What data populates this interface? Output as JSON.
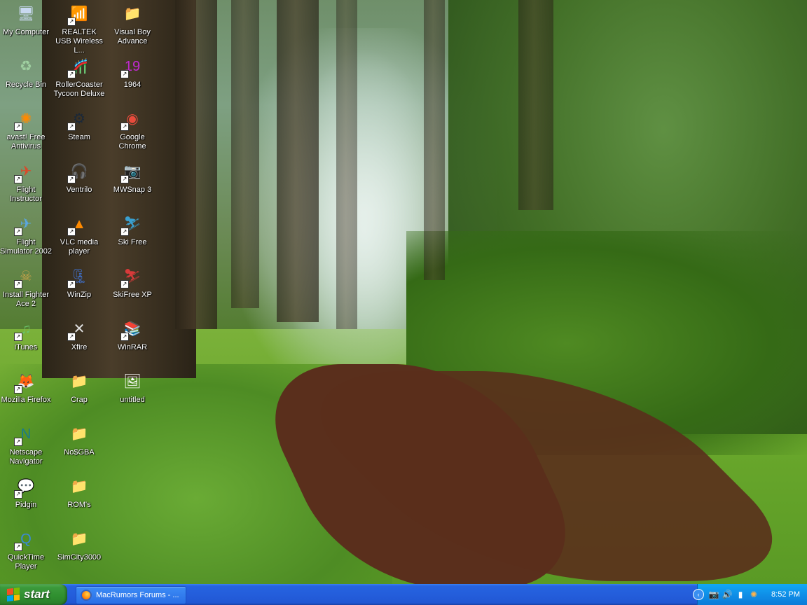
{
  "desktop": {
    "icons": [
      {
        "label": "My Computer",
        "glyph": "🖥",
        "color": "#c8d8f0",
        "shortcut": false,
        "col": 0,
        "row": 0
      },
      {
        "label": "REALTEK USB Wireless L...",
        "glyph": "📶",
        "color": "#1a3fbf",
        "shortcut": true,
        "col": 1,
        "row": 0
      },
      {
        "label": "Visual Boy Advance",
        "glyph": "📁",
        "color": "#f3d26b",
        "shortcut": false,
        "col": 2,
        "row": 0
      },
      {
        "label": "Recycle Bin",
        "glyph": "♻",
        "color": "#9fd0a0",
        "shortcut": false,
        "col": 0,
        "row": 1
      },
      {
        "label": "RollerCoaster Tycoon Deluxe",
        "glyph": "🎢",
        "color": "#c0282e",
        "shortcut": true,
        "col": 1,
        "row": 1
      },
      {
        "label": "1964",
        "glyph": "19",
        "color": "#c02ad0",
        "shortcut": true,
        "col": 2,
        "row": 1
      },
      {
        "label": "avast! Free Antivirus",
        "glyph": "✺",
        "color": "#ff8a00",
        "shortcut": true,
        "col": 0,
        "row": 2
      },
      {
        "label": "Steam",
        "glyph": "⚙",
        "color": "#1b2838",
        "shortcut": true,
        "col": 1,
        "row": 2
      },
      {
        "label": "Google Chrome",
        "glyph": "◉",
        "color": "#e84b3c",
        "shortcut": true,
        "col": 2,
        "row": 2
      },
      {
        "label": "Flight Instructor",
        "glyph": "✈",
        "color": "#d84a2a",
        "shortcut": true,
        "col": 0,
        "row": 3
      },
      {
        "label": "Ventrilo",
        "glyph": "🎧",
        "color": "#d8d8d8",
        "shortcut": true,
        "col": 1,
        "row": 3
      },
      {
        "label": "MWSnap 3",
        "glyph": "📷",
        "color": "#555555",
        "shortcut": true,
        "col": 2,
        "row": 3
      },
      {
        "label": "Flight Simulator 2002",
        "glyph": "✈",
        "color": "#5aa7e0",
        "shortcut": true,
        "col": 0,
        "row": 4
      },
      {
        "label": "VLC media player",
        "glyph": "▲",
        "color": "#ff8a00",
        "shortcut": true,
        "col": 1,
        "row": 4
      },
      {
        "label": "Ski Free",
        "glyph": "⛷",
        "color": "#3aa0d0",
        "shortcut": true,
        "col": 2,
        "row": 4
      },
      {
        "label": "Install Fighter Ace 2",
        "glyph": "☠",
        "color": "#c9a24a",
        "shortcut": true,
        "col": 0,
        "row": 5
      },
      {
        "label": "WinZip",
        "glyph": "🗜",
        "color": "#3f6fc8",
        "shortcut": true,
        "col": 1,
        "row": 5
      },
      {
        "label": "SkiFree XP",
        "glyph": "⛷",
        "color": "#d83a3a",
        "shortcut": true,
        "col": 2,
        "row": 5
      },
      {
        "label": "iTunes",
        "glyph": "♫",
        "color": "#6ac26a",
        "shortcut": true,
        "col": 0,
        "row": 6
      },
      {
        "label": "Xfire",
        "glyph": "✕",
        "color": "#e0e0e0",
        "shortcut": true,
        "col": 1,
        "row": 6
      },
      {
        "label": "WinRAR",
        "glyph": "📚",
        "color": "#9a2a7a",
        "shortcut": true,
        "col": 2,
        "row": 6
      },
      {
        "label": "Mozilla Firefox",
        "glyph": "🦊",
        "color": "#ff7a00",
        "shortcut": true,
        "col": 0,
        "row": 7
      },
      {
        "label": "Crap",
        "glyph": "📁",
        "color": "#f3d26b",
        "shortcut": false,
        "col": 1,
        "row": 7
      },
      {
        "label": "untitled",
        "glyph": "🖼",
        "color": "#ffffff",
        "shortcut": false,
        "col": 2,
        "row": 7
      },
      {
        "label": "Netscape Navigator",
        "glyph": "N",
        "color": "#1a7a8a",
        "shortcut": true,
        "col": 0,
        "row": 8
      },
      {
        "label": "No$GBA",
        "glyph": "📁",
        "color": "#f3d26b",
        "shortcut": false,
        "col": 1,
        "row": 8
      },
      {
        "label": "Pidgin",
        "glyph": "💬",
        "color": "#8a6ad0",
        "shortcut": true,
        "col": 0,
        "row": 9
      },
      {
        "label": "ROM's",
        "glyph": "📁",
        "color": "#f3d26b",
        "shortcut": false,
        "col": 1,
        "row": 9
      },
      {
        "label": "QuickTime Player",
        "glyph": "Q",
        "color": "#3a8ad8",
        "shortcut": true,
        "col": 0,
        "row": 10
      },
      {
        "label": "SimCity3000",
        "glyph": "📁",
        "color": "#f3d26b",
        "shortcut": false,
        "col": 1,
        "row": 10
      }
    ]
  },
  "taskbar": {
    "start_label": "start",
    "tasks": [
      {
        "label": "MacRumors Forums - ...",
        "icon": "firefox-icon"
      }
    ],
    "tray": {
      "clock": "8:52 PM",
      "icons": [
        "network-camera-icon",
        "sound-icon",
        "signal-icon",
        "avast-icon"
      ]
    }
  }
}
